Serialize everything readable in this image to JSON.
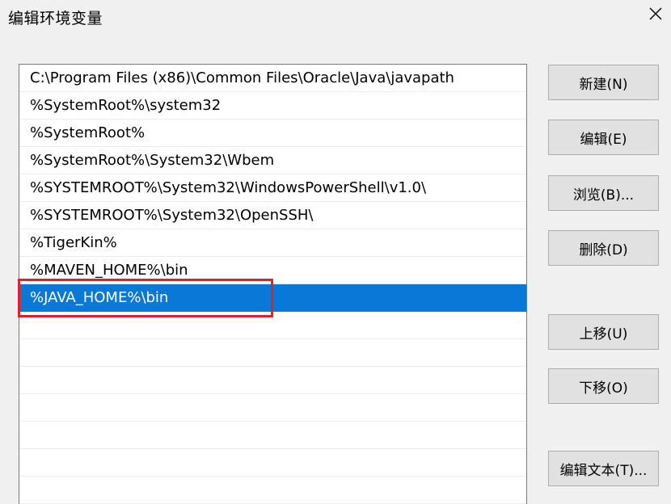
{
  "dialog": {
    "title": "编辑环境变量"
  },
  "path_list": {
    "items": [
      {
        "label": "C:\\Program Files (x86)\\Common Files\\Oracle\\Java\\javapath",
        "selected": false
      },
      {
        "label": "%SystemRoot%\\system32",
        "selected": false
      },
      {
        "label": "%SystemRoot%",
        "selected": false
      },
      {
        "label": "%SystemRoot%\\System32\\Wbem",
        "selected": false
      },
      {
        "label": "%SYSTEMROOT%\\System32\\WindowsPowerShell\\v1.0\\",
        "selected": false
      },
      {
        "label": "%SYSTEMROOT%\\System32\\OpenSSH\\",
        "selected": false
      },
      {
        "label": "%TigerKin%",
        "selected": false
      },
      {
        "label": "%MAVEN_HOME%\\bin",
        "selected": false
      },
      {
        "label": "%JAVA_HOME%\\bin",
        "selected": true
      }
    ],
    "selected_color": "#0a78d7",
    "annotation_color": "#e0202a"
  },
  "buttons": {
    "new": "新建(N)",
    "edit": "编辑(E)",
    "browse": "浏览(B)...",
    "delete": "删除(D)",
    "move_up": "上移(U)",
    "move_down": "下移(O)",
    "edit_text": "编辑文本(T)..."
  },
  "icons": {
    "close": "close-icon"
  }
}
